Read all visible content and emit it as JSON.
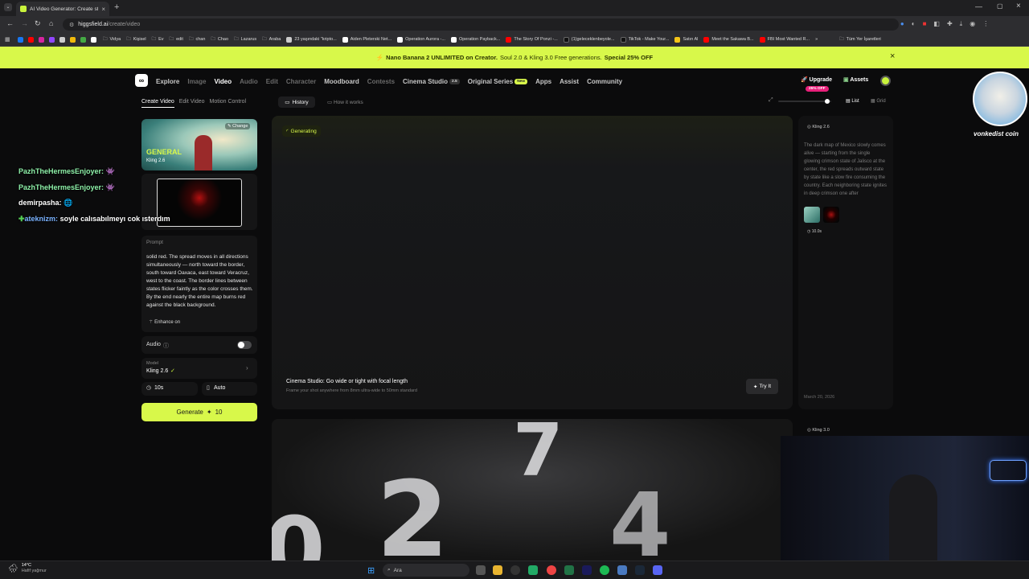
{
  "browser": {
    "tab_title": "AI Video Generator: Create stu...",
    "url_host": "higgsfield.ai",
    "url_path": "/create/video",
    "bookmarks": [
      "Vidya",
      "Kişisel",
      "Ev",
      "edit",
      "chan",
      "Chao",
      "Lazarus",
      "Araba",
      "23 yaşındaki \"kripto...",
      "Aiden Pleterski Net...",
      "Operation Aurora -...",
      "Operation Payback...",
      "The Story Of Ponzi -...",
      "(1)geleceklenbeyole...",
      "TikTok - Make Your...",
      "Satın Al",
      "Meet the Sakawa B...",
      "FBI Most Wanted R...",
      "»",
      "Tüm Yer İşaretleri"
    ]
  },
  "promo": {
    "part1": "Nano Banana 2 UNLIMITED on Creator.",
    "part2": "Soul 2.0 & Kling 3.0 Free generations.",
    "part3": "Special 25% OFF"
  },
  "nav": {
    "items": [
      "Explore",
      "Image",
      "Video",
      "Audio",
      "Edit",
      "Character",
      "Moodboard",
      "Contests",
      "Cinema Studio",
      "Original Series",
      "Apps",
      "Assist",
      "Community"
    ],
    "cinema_badge": "2.5",
    "original_badge": "New",
    "upgrade": "Upgrade",
    "upgrade_badge": "25% OFF",
    "assets": "Assets"
  },
  "left": {
    "tabs": [
      "Create Video",
      "Edit Video",
      "Motion Control"
    ],
    "preset_title": "GENERAL",
    "preset_model": "Kling 2.6",
    "change": "Change",
    "prompt_label": "Prompt",
    "prompt_text": "solid red. The spread moves in all directions simultaneously — north toward the border, south toward Oaxaca, east toward Veracruz, west to the coast. The border lines between states flicker faintly as the color crosses them. By the end nearly the entire map burns red against the black background.",
    "enhance": "Enhance on",
    "audio_label": "Audio",
    "model_label": "Model",
    "model_value": "Kling 2.6",
    "duration": "10s",
    "aspect": "Auto",
    "generate": "Generate",
    "generate_cost": "10"
  },
  "toolbar": {
    "history": "History",
    "how": "How it works",
    "list": "List",
    "grid": "Grid"
  },
  "main": {
    "status": "Generating",
    "tip_title": "Cinema Studio: Go wide or tight with focal length",
    "tip_sub": "Frame your shot anywhere from 8mm ultra-wide to 50mm standard",
    "try": "Try It"
  },
  "side": {
    "model": "Kling 2.6",
    "desc": "The dark map of Mexico slowly comes alive — starting from the single glowing crimson state of Jalisco at the center, the red spreads outward state by state like a slow fire consuming the country. Each neighboring state ignites in deep crimson one after",
    "duration": "10.0s",
    "date": "March 20, 2026",
    "model2": "Kling 3.0"
  },
  "chat": [
    {
      "user": "PazhTheHermesEnjoyer:",
      "msg": ""
    },
    {
      "user": "PazhTheHermesEnjoyer:",
      "msg": ""
    },
    {
      "user": "demirpasha:",
      "msg": ""
    },
    {
      "user": "ateknizm:",
      "msg": "soyle calısabılmeyı cok ısterdım"
    }
  ],
  "streamer": {
    "name": "vonkedist coin"
  },
  "weather": {
    "temp": "14°C",
    "desc": "Hafif yağmur"
  },
  "taskbar": {
    "search": "Ara"
  },
  "colors": {
    "accent": "#d8f84a",
    "bg": "#0b0b0c",
    "upgrade_badge": "#e8207a"
  }
}
